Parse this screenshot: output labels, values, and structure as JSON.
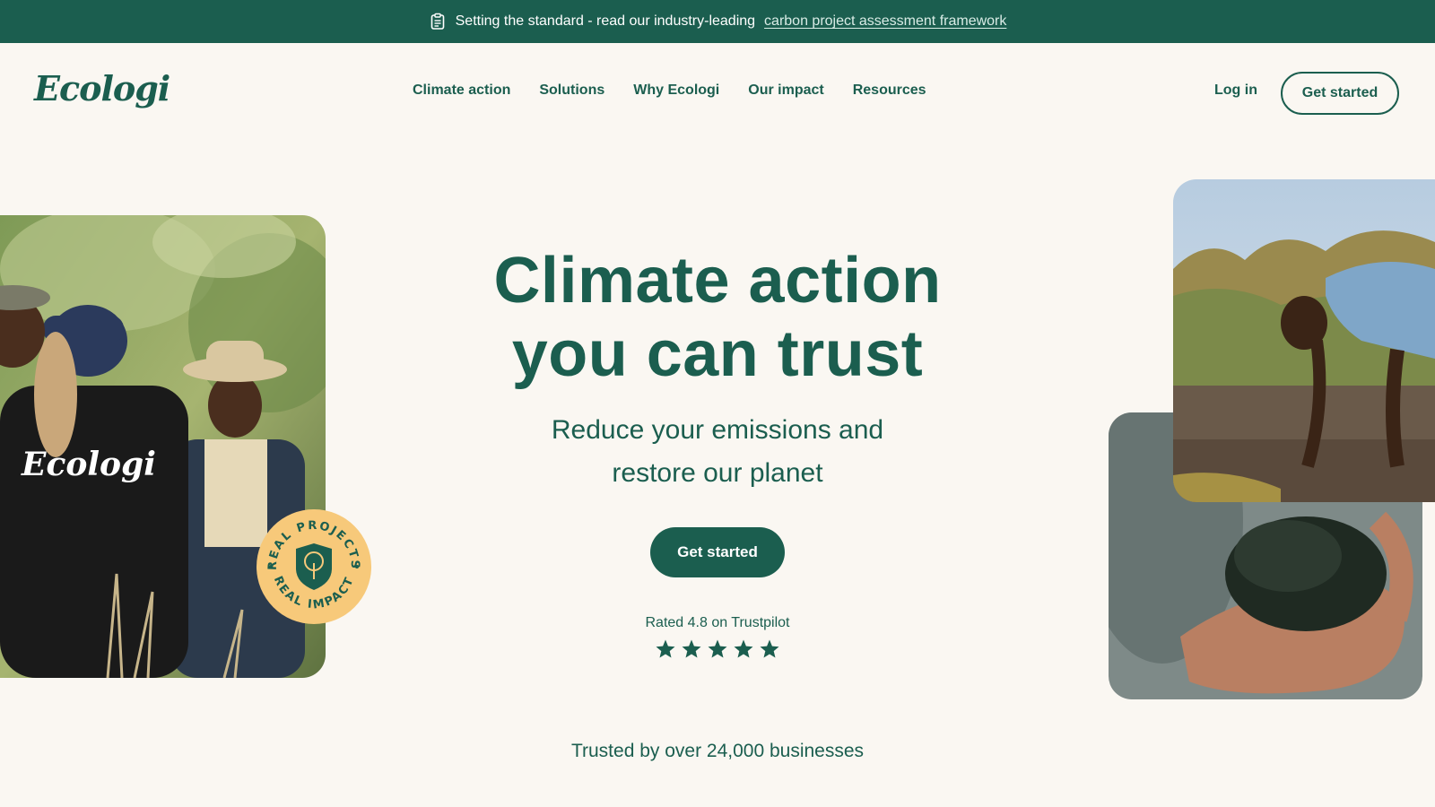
{
  "banner": {
    "text": "Setting the standard - read our industry-leading",
    "link": "carbon project assessment framework",
    "icon": "clipboard-icon"
  },
  "header": {
    "logo": "Ecologi",
    "nav": [
      {
        "label": "Climate action"
      },
      {
        "label": "Solutions"
      },
      {
        "label": "Why Ecologi"
      },
      {
        "label": "Our impact"
      },
      {
        "label": "Resources"
      }
    ],
    "login": "Log in",
    "cta": "Get started"
  },
  "hero": {
    "title_line1": "Climate action",
    "title_line2": "you can trust",
    "subtitle_line1": "Reduce your emissions and",
    "subtitle_line2": "restore our planet",
    "cta": "Get started",
    "rating_text": "Rated 4.8 on Trustpilot",
    "rating_stars": 5
  },
  "badge": {
    "top_text": "REAL PROJECTS",
    "bottom_text": "REAL IMPACT",
    "icon": "tree-shield-icon"
  },
  "photo_left": {
    "shirt_text": "Ecologi"
  },
  "trusted_text": "Trusted by over 24,000 businesses",
  "colors": {
    "brand": "#1B5E4F",
    "background": "#FAF7F2",
    "badge": "#F7C97A"
  }
}
